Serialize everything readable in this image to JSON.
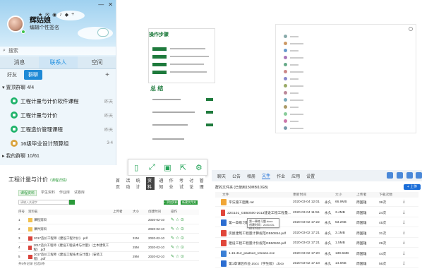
{
  "qq": {
    "nickname": "辉姑娘",
    "signature": "编辑个性签名",
    "search_placeholder": "搜索",
    "main_tabs": [
      "消息",
      "联系人",
      "空间"
    ],
    "sub_tabs": [
      "好友",
      "群聊"
    ],
    "group_header": "置顶群聊 4/4",
    "groups": [
      {
        "name": "工程计量与计价软件课程",
        "time": "昨天"
      },
      {
        "name": "工程计量与计价",
        "time": "昨天"
      },
      {
        "name": "工程造价管理课程",
        "time": "昨天"
      },
      {
        "name": "16级毕业设计预算组",
        "time": "3-4"
      }
    ],
    "my_groups": "我的群聊 10/61"
  },
  "slide1": {
    "title": "操作步骤"
  },
  "slide2": {
    "title": "总 结"
  },
  "toolbar": {
    "icons": [
      "tablet-icon",
      "expand-icon",
      "save-icon",
      "share-icon",
      "settings-icon"
    ]
  },
  "course": {
    "title": "工程计量与计价",
    "title_sub": "（课程详情）",
    "nav": [
      "首页",
      "活动",
      "统计",
      "资料",
      "通知",
      "作业",
      "考试",
      "讨论",
      "管理"
    ],
    "tabs": [
      "课程资料",
      "学生资料",
      "作业库",
      "试卷库"
    ],
    "search_placeholder": "请输入关键字",
    "btn_add": "+ 添加资料",
    "btn_new": "新建文件夹",
    "headers": [
      "序号",
      "资料名",
      "上传者",
      "大小",
      "创建时间",
      "",
      "操作"
    ],
    "rows": [
      {
        "n": "1",
        "name": "课程资料",
        "size": "",
        "date": "2020-02-10"
      },
      {
        "n": "2",
        "name": "课件资料",
        "size": "",
        "date": "2020-02-10"
      },
      {
        "n": "3",
        "name": "2017造价工程师《建设工程计价》.pdf",
        "size": "31M",
        "date": "2020-02-10"
      },
      {
        "n": "4",
        "name": "2017造价工程师《建设工程技术与计量》（土木建筑工程）.pdf",
        "size": "25M",
        "date": "2020-02-10"
      },
      {
        "n": "5",
        "name": "2017造价工程师《建设工程技术与计量》（安装工程）.pdf",
        "size": "29M",
        "date": "2020-02-10"
      }
    ],
    "footer": "共5条记录  已选0条"
  },
  "files": {
    "nav": [
      "聊天",
      "公告",
      "相册",
      "文件",
      "作业",
      "应用",
      "设置"
    ],
    "path": "群的文件夹 (已使用150MB/10GB)",
    "upload": "+ 上传",
    "headers": [
      "文件",
      "更新时间",
      "大小",
      "上传者",
      "下载次数"
    ],
    "rows": [
      {
        "name": "平法施工图集.rar",
        "date": "2020-03-04 12:01",
        "left": "永久",
        "size": "66.9MB",
        "by": "周国雄",
        "dl": "38次"
      },
      {
        "name": "22G101_GB50500-2013建设工程工程量清单计价规范.pdf",
        "date": "2020-03-04 11:56",
        "left": "永久",
        "size": "3.4MB",
        "by": "周国雄",
        "dl": "24次"
      },
      {
        "name": "第一章练习题.docx",
        "date": "2020-03-02 17:22",
        "left": "永久",
        "size": "53.2KB",
        "by": "周国雄",
        "dl": "45次"
      },
      {
        "name": "房屋建筑工程量计算规范GB50854.pdf",
        "date": "2020-03-02 17:21",
        "left": "永久",
        "size": "3.1MB",
        "by": "周国雄",
        "dl": "31次"
      },
      {
        "name": "建设工程工程量计价规范GB50500.pdf",
        "date": "2020-03-02 17:21",
        "left": "永久",
        "size": "1.5MB",
        "by": "周国雄",
        "dl": "29次"
      },
      {
        "name": "1.15.412_paidsuit_release.exe",
        "date": "2020-03-02 17:20",
        "left": "永久",
        "size": "139.5MB",
        "by": "周国雄",
        "dl": "44次"
      },
      {
        "name": "第1章课后作业.docx（学生版）.docx",
        "date": "2020-03-02 17:18",
        "left": "永久",
        "size": "14.6KB",
        "by": "周国雄",
        "dl": "56次"
      }
    ],
    "tooltip": [
      "第一章练习题.docx",
      "创建时间：2020-03-02 17:22"
    ]
  },
  "colors": {
    "qq_blue": "#1d8ee0",
    "green": "#1e7a3c",
    "file_blue": "#1a6dd8"
  }
}
